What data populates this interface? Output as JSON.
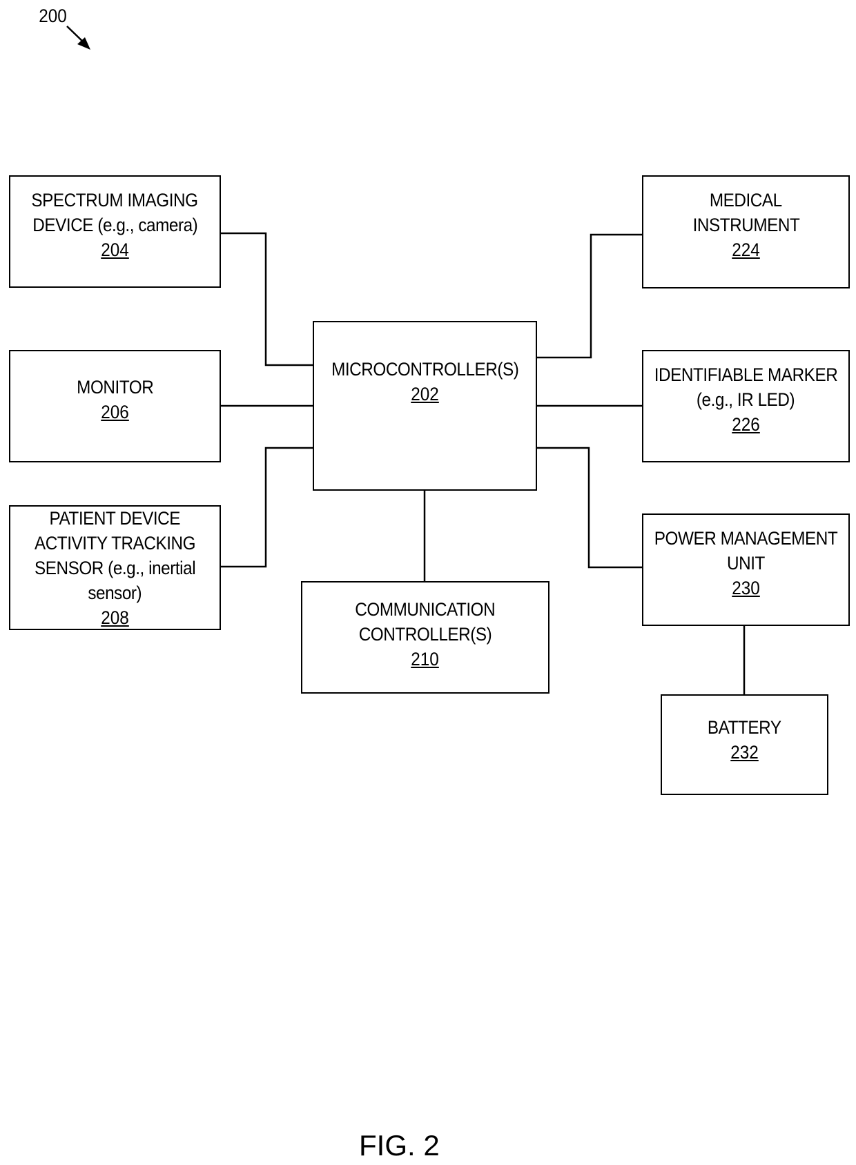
{
  "figure": {
    "reference": "200",
    "caption": "FIG. 2"
  },
  "blocks": {
    "microcontroller": {
      "label": [
        "MICROCONTROLLER(S)"
      ],
      "ref": "202"
    },
    "spectrum_imaging": {
      "label": [
        "SPECTRUM IMAGING",
        "DEVICE (e.g., camera)"
      ],
      "ref": "204"
    },
    "monitor": {
      "label": [
        "MONITOR"
      ],
      "ref": "206"
    },
    "patient_sensor": {
      "label": [
        "PATIENT DEVICE",
        "ACTIVITY TRACKING",
        "SENSOR (e.g., inertial",
        "sensor)"
      ],
      "ref": "208"
    },
    "communication": {
      "label": [
        "COMMUNICATION",
        "CONTROLLER(S)"
      ],
      "ref": "210"
    },
    "medical_instrument": {
      "label": [
        "MEDICAL",
        "INSTRUMENT"
      ],
      "ref": "224"
    },
    "identifiable_marker": {
      "label": [
        "IDENTIFIABLE MARKER",
        "(e.g., IR LED)"
      ],
      "ref": "226"
    },
    "power_management": {
      "label": [
        "POWER MANAGEMENT",
        "UNIT"
      ],
      "ref": "230"
    },
    "battery": {
      "label": [
        "BATTERY"
      ],
      "ref": "232"
    }
  },
  "connections": [
    [
      "spectrum_imaging",
      "microcontroller"
    ],
    [
      "monitor",
      "microcontroller"
    ],
    [
      "patient_sensor",
      "microcontroller"
    ],
    [
      "microcontroller",
      "communication"
    ],
    [
      "microcontroller",
      "medical_instrument"
    ],
    [
      "microcontroller",
      "identifiable_marker"
    ],
    [
      "microcontroller",
      "power_management"
    ],
    [
      "power_management",
      "battery"
    ]
  ]
}
